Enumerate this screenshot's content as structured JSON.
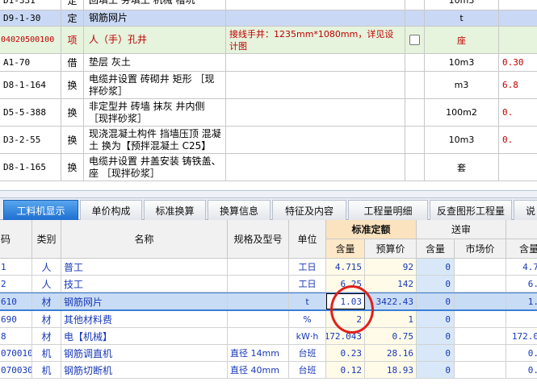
{
  "top_rows": [
    {
      "code": "D1-331",
      "type": "定",
      "name": "回填土 夯填土 机械 槽坑",
      "spec": "",
      "unit": "10m3",
      "qty": ""
    },
    {
      "code": "D9-1-30",
      "type": "定",
      "name": "钢筋网片",
      "spec": "",
      "unit": "t",
      "qty": ""
    },
    {
      "code": "04020500100",
      "type": "项",
      "name": "人（手）孔井",
      "spec": "接线手井：1235mm*1080mm，详见设计图",
      "unit": "座",
      "qty": ""
    },
    {
      "code": "A1-70",
      "type": "借",
      "name": "垫层 灰土",
      "spec": "",
      "unit": "10m3",
      "qty": "0.30"
    },
    {
      "code": "D8-1-164",
      "type": "换",
      "name": "电缆井设置 砖砌井 矩形 ［现拌砂浆］",
      "spec": "",
      "unit": "m3",
      "qty": "6.8"
    },
    {
      "code": "D5-5-388",
      "type": "换",
      "name": "非定型井 砖墙 抹灰 井内侧 ［现拌砂浆］",
      "spec": "",
      "unit": "100m2",
      "qty": "0."
    },
    {
      "code": "D3-2-55",
      "type": "换",
      "name": "现浇混凝土构件 挡墙压顶 混凝土  换为【预拌混凝土 C25】",
      "spec": "",
      "unit": "10m3",
      "qty": "0."
    },
    {
      "code": "D8-1-165",
      "type": "换",
      "name": "电缆井设置 井盖安装 铸铁盖、座 ［现拌砂浆］",
      "spec": "",
      "unit": "套",
      "qty": ""
    }
  ],
  "tabs": [
    {
      "label": "工料机显示"
    },
    {
      "label": "单价构成"
    },
    {
      "label": "标准换算"
    },
    {
      "label": "换算信息"
    },
    {
      "label": "特征及内容"
    },
    {
      "label": "工程量明细"
    },
    {
      "label": "反查图形工程量"
    },
    {
      "label": "说"
    }
  ],
  "headers": {
    "code": "码",
    "type": "类别",
    "name": "名称",
    "spec": "规格及型号",
    "unit": "单位",
    "std_group": "标准定额",
    "amount": "含量",
    "budget_price": "预算价",
    "sub_group": "送审",
    "sub_amount": "含量",
    "market_price": "市场价",
    "last": "含量"
  },
  "rows": [
    {
      "code": "1",
      "type": "人",
      "name": "普工",
      "spec": "",
      "unit": "工日",
      "amount": "4.715",
      "price": "92",
      "sub_amount": "0",
      "market": "",
      "last": "4.7"
    },
    {
      "code": "2",
      "type": "人",
      "name": "技工",
      "spec": "",
      "unit": "工日",
      "amount": "6.25",
      "price": "142",
      "sub_amount": "0",
      "market": "",
      "last": "6."
    },
    {
      "code": "610",
      "type": "材",
      "name": "钢筋网片",
      "spec": "",
      "unit": "t",
      "amount": "1.03",
      "price": "3422.43",
      "sub_amount": "0",
      "market": "",
      "last": "1."
    },
    {
      "code": "690",
      "type": "材",
      "name": "其他材料费",
      "spec": "",
      "unit": "%",
      "amount": "2",
      "price": "1",
      "sub_amount": "0",
      "market": "",
      "last": ""
    },
    {
      "code": "8",
      "type": "材",
      "name": "电【机械】",
      "spec": "",
      "unit": "kW·h",
      "amount": "172.043",
      "price": "0.75",
      "sub_amount": "0",
      "market": "",
      "last": "172.0"
    },
    {
      "code": "070010",
      "type": "机",
      "name": "钢筋调直机",
      "spec": "直径 14mm",
      "unit": "台班",
      "amount": "0.23",
      "price": "28.16",
      "sub_amount": "0",
      "market": "",
      "last": "0."
    },
    {
      "code": "070030",
      "type": "机",
      "name": "钢筋切断机",
      "spec": "直径 40mm",
      "unit": "台班",
      "amount": "0.12",
      "price": "18.93",
      "sub_amount": "0",
      "market": "",
      "last": "0."
    }
  ],
  "colors": {
    "accent": "#1e6fd0",
    "selected_row": "#c9dcf5",
    "highlight_circle": "#e0201c",
    "std_header": "#fbe3bf"
  }
}
